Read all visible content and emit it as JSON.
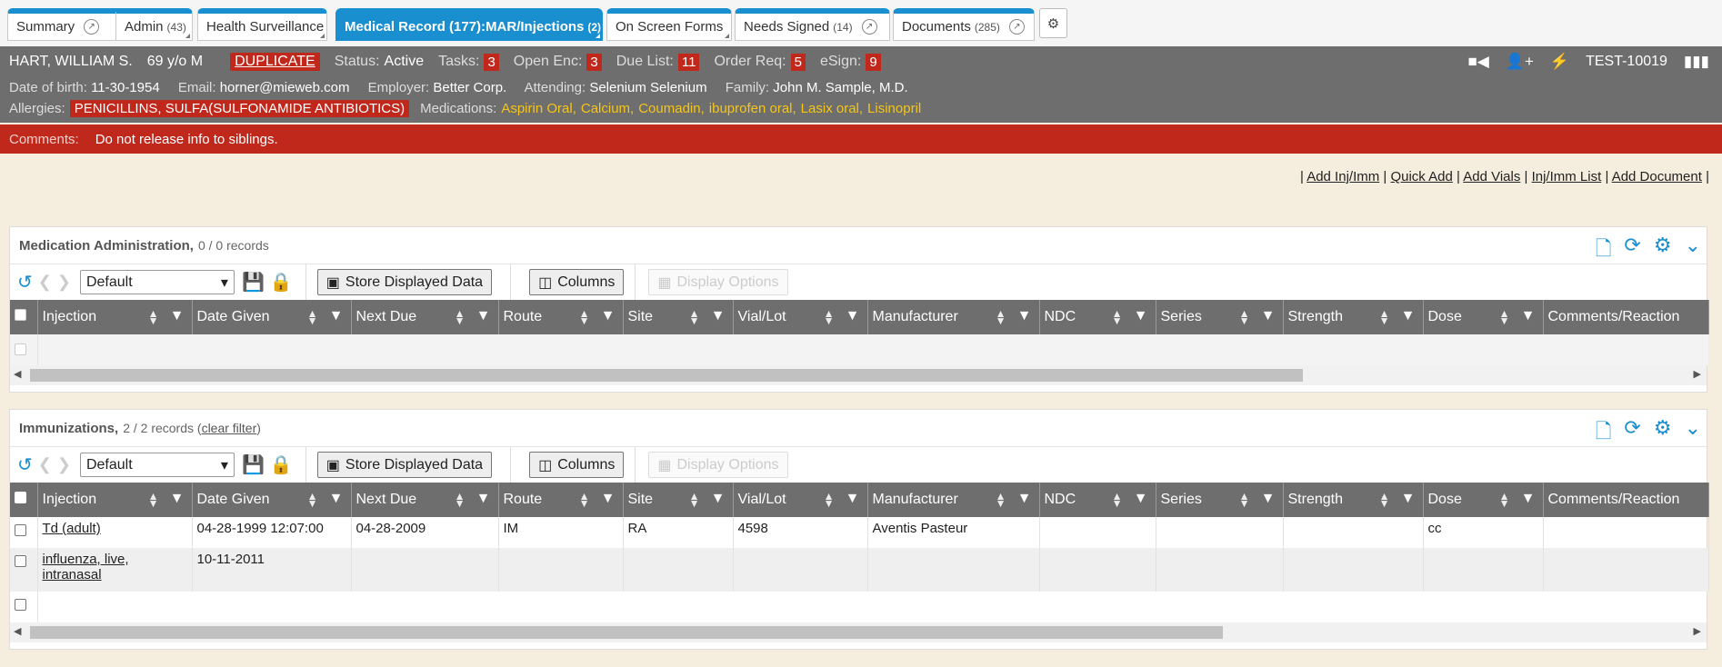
{
  "tabs": [
    {
      "label": "Summary",
      "count": "",
      "ext": true,
      "active": false
    },
    {
      "label": "Admin",
      "count": "(43)",
      "ext": false,
      "active": false
    },
    {
      "label": "Health Surveillance",
      "count": "",
      "ext": false,
      "active": false
    },
    {
      "label": "Medical Record (177):MAR/Injections",
      "count": "(2)",
      "ext": false,
      "active": true
    },
    {
      "label": "On Screen Forms",
      "count": "",
      "ext": false,
      "active": false
    },
    {
      "label": "Needs Signed",
      "count": "(14)",
      "ext": true,
      "active": false
    },
    {
      "label": "Documents",
      "count": "(285)",
      "ext": true,
      "active": false
    }
  ],
  "patient": {
    "name": "HART, WILLIAM S.",
    "age_sex": "69 y/o M",
    "duplicate": "DUPLICATE",
    "status_label": "Status:",
    "status": "Active",
    "tasks_label": "Tasks:",
    "tasks": "3",
    "open_enc_label": "Open Enc:",
    "open_enc": "3",
    "due_list_label": "Due List:",
    "due_list": "11",
    "order_req_label": "Order Req:",
    "order_req": "5",
    "esign_label": "eSign:",
    "esign": "9",
    "chart_id": "TEST-10019",
    "dob_label": "Date of birth:",
    "dob": "11-30-1954",
    "email_label": "Email:",
    "email": "horner@mieweb.com",
    "employer_label": "Employer:",
    "employer": "Better Corp.",
    "attending_label": "Attending:",
    "attending": "Selenium Selenium",
    "family_label": "Family:",
    "family": "John M. Sample, M.D.",
    "allergies_label": "Allergies:",
    "allergies": "PENICILLINS, SULFA(SULFONAMIDE ANTIBIOTICS)",
    "medications_label": "Medications:",
    "medications": [
      "Aspirin Oral",
      "Calcium",
      "Coumadin",
      "ibuprofen oral",
      "Lasix oral",
      "Lisinopril"
    ],
    "comments_label": "Comments:",
    "comments": "Do not release info to siblings."
  },
  "actions": [
    "Add Inj/Imm",
    "Quick Add",
    "Add Vials",
    "Inj/Imm List",
    "Add Document"
  ],
  "columns": [
    "Injection",
    "Date Given",
    "Next Due",
    "Route",
    "Site",
    "Vial/Lot",
    "Manufacturer",
    "NDC",
    "Series",
    "Strength",
    "Dose",
    "Comments/Reaction"
  ],
  "med_admin": {
    "title": "Medication Administration,",
    "count": "0 / 0 records",
    "view": "Default",
    "store_label": "Store Displayed Data",
    "columns_label": "Columns",
    "display_options_label": "Display Options"
  },
  "immunizations": {
    "title": "Immunizations,",
    "count": "2 / 2 records (",
    "clear_filter": "clear filter",
    "count_close": ")",
    "view": "Default",
    "store_label": "Store Displayed Data",
    "columns_label": "Columns",
    "display_options_label": "Display Options",
    "rows": [
      [
        "Td (adult)",
        "04-28-1999 12:07:00",
        "04-28-2009",
        "IM",
        "RA",
        "4598",
        "Aventis Pasteur",
        "",
        "",
        "",
        "cc",
        ""
      ],
      [
        "influenza, live, intranasal",
        "10-11-2011",
        "",
        "",
        "",
        "",
        "",
        "",
        "",
        "",
        "",
        ""
      ]
    ]
  },
  "colors": {
    "accent": "#1a8fd0",
    "alert": "#c0281c",
    "banner": "#6e6e6e",
    "med": "#f5c518"
  }
}
